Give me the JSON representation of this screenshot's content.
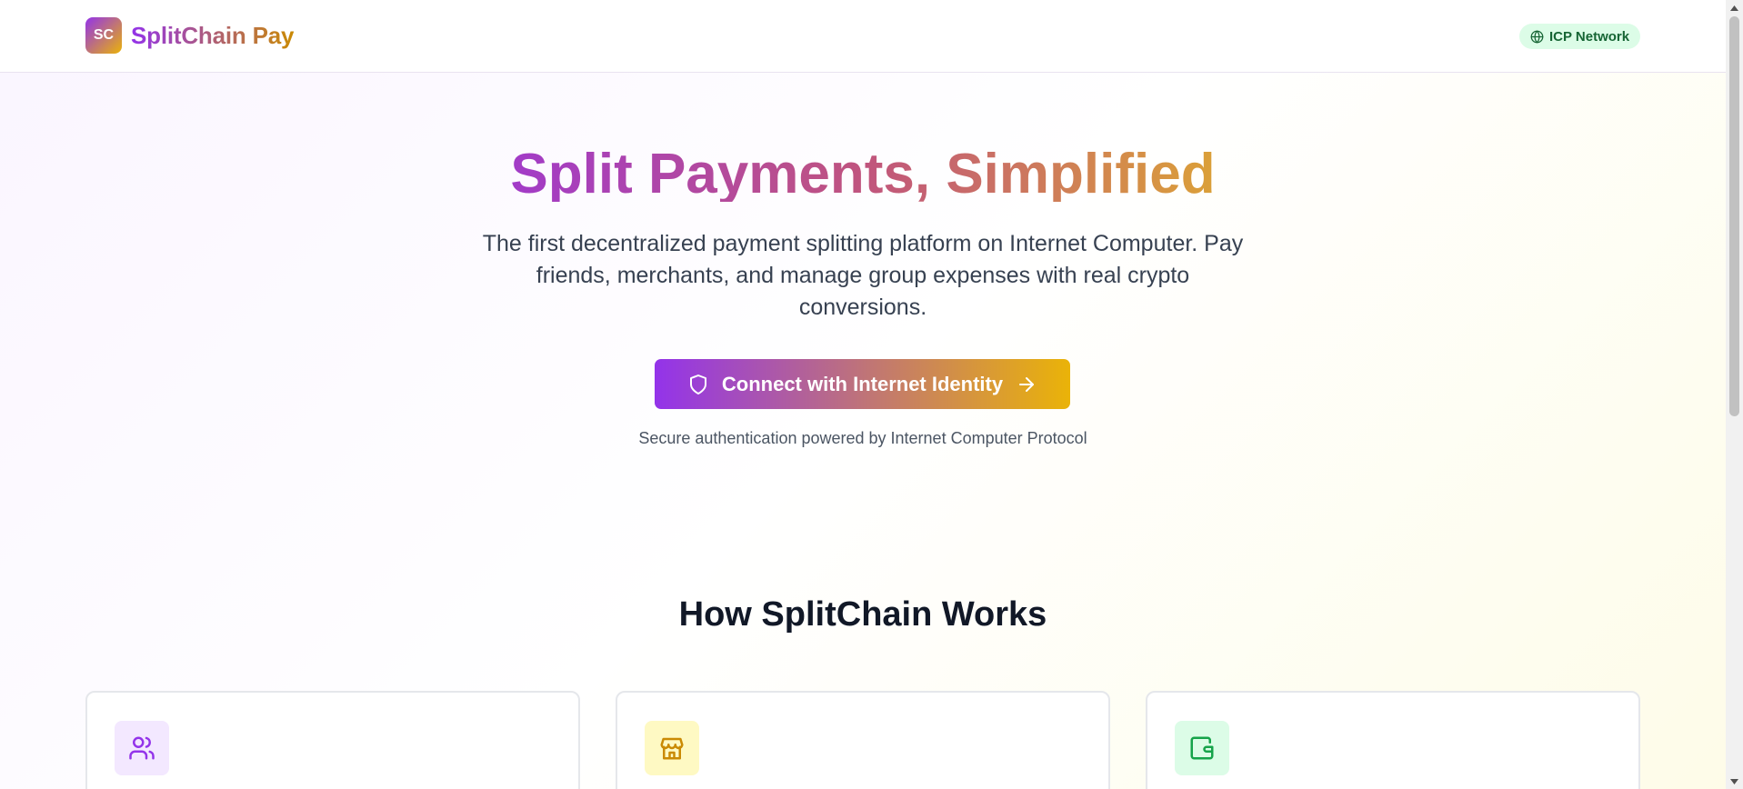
{
  "header": {
    "logo_mark": "SC",
    "brand": "SplitChain Pay",
    "network_badge": "ICP Network"
  },
  "hero": {
    "title": "Split Payments, Simplified",
    "subtitle": "The first decentralized payment splitting platform on Internet Computer. Pay friends, merchants, and manage group expenses with real crypto conversions.",
    "cta_label": "Connect with Internet Identity",
    "cta_note": "Secure authentication powered by Internet Computer Protocol"
  },
  "how_it_works": {
    "title": "How SplitChain Works",
    "cards": [
      {
        "icon": "users-icon",
        "color": "#9333ea"
      },
      {
        "icon": "store-icon",
        "color": "#ca8a04"
      },
      {
        "icon": "wallet-icon",
        "color": "#16a34a"
      }
    ]
  },
  "colors": {
    "brand_purple": "#9333ea",
    "brand_yellow": "#eab308",
    "badge_green_bg": "#dcfce7",
    "badge_green_text": "#166534"
  }
}
